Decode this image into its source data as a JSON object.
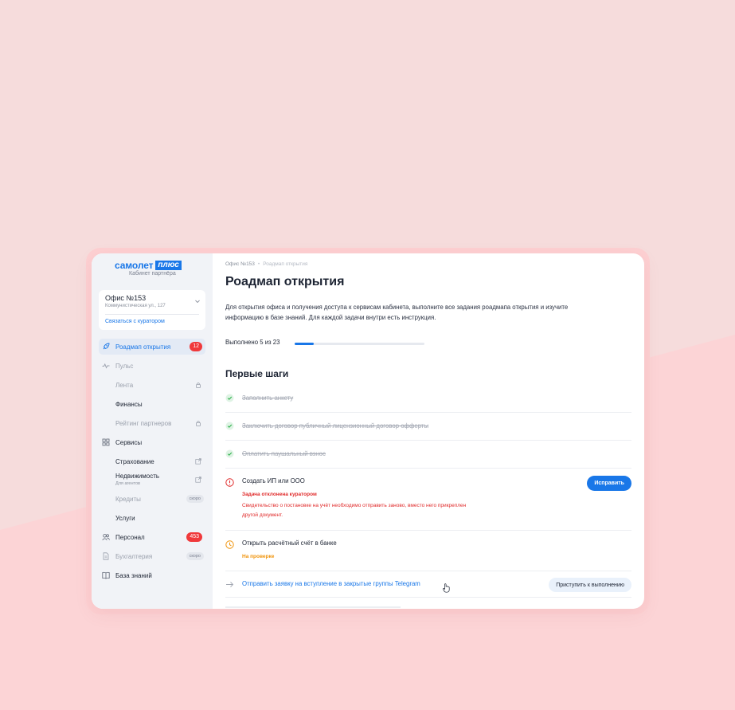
{
  "colors": {
    "background": "#f6dcdc",
    "accent": "#1977e8",
    "danger": "#f0393b",
    "warning": "#f0930a",
    "success": "#2fb24c"
  },
  "brand": {
    "logo_text": "самолет",
    "logo_badge": "плюс",
    "subtitle": "Кабинет партнёра"
  },
  "office": {
    "name": "Офис №153",
    "address": "Коммунистическая ул., 127",
    "contact_link": "Связаться с куратором"
  },
  "sidebar": {
    "items": [
      {
        "label": "Роадмап открытия",
        "icon": "rocket-icon",
        "badge": "12",
        "active": true
      },
      {
        "label": "Пульс",
        "icon": "pulse-icon",
        "muted": true
      },
      {
        "label": "Лента",
        "sub": true,
        "muted": true,
        "right_icon": "lock-icon"
      },
      {
        "label": "Финансы",
        "sub": true
      },
      {
        "label": "Рейтинг партнеров",
        "sub": true,
        "muted": true,
        "right_icon": "lock-icon"
      },
      {
        "label": "Сервисы",
        "icon": "grid-icon"
      },
      {
        "label": "Страхование",
        "sub": true,
        "right_icon": "external-link-icon"
      },
      {
        "label": "Недвижимость",
        "sub": true,
        "hint": "Для агентов",
        "right_icon": "external-link-icon"
      },
      {
        "label": "Кредиты",
        "sub": true,
        "muted": true,
        "soon": "скоро"
      },
      {
        "label": "Услуги",
        "sub": true
      },
      {
        "label": "Персонал",
        "icon": "people-icon",
        "badge": "453"
      },
      {
        "label": "Бухгалтерия",
        "icon": "document-icon",
        "muted": true,
        "soon": "скоро"
      },
      {
        "label": "База знаний",
        "icon": "book-icon"
      }
    ]
  },
  "breadcrumb": {
    "items": [
      "Офис №153",
      "Роадмап открытия"
    ]
  },
  "page": {
    "title": "Роадмап открытия",
    "intro": "Для открытия офиса и получения доступа к сервисам кабинета, выполните все задания роадмапа открытия и изучите информацию в базе знаний.  Для каждой задачи внутри есть инструкция.",
    "progress_label": "Выполнено 5 из 23",
    "progress_fraction": 0.15,
    "section_title": "Первые шаги"
  },
  "tasks": [
    {
      "title": "Заполнить анкету",
      "state": "done",
      "icon": "check-circle-icon"
    },
    {
      "title": "Заключить договор публичный лицензионный договор офферты",
      "state": "done",
      "icon": "check-circle-icon"
    },
    {
      "title": "Оплатить паушальный взнос",
      "state": "done",
      "icon": "check-circle-icon"
    },
    {
      "title": "Создать ИП или ООО",
      "state": "rejected",
      "icon": "alert-circle-icon",
      "status": "Задача отклонена куратором",
      "note": "Свидетельство о постановке на учёт необходимо отправить заново, вместо него прикреплен другой документ.",
      "button": "Исправить"
    },
    {
      "title": "Открыть расчётный счёт в банке",
      "state": "review",
      "icon": "clock-icon",
      "status": "На проверке"
    },
    {
      "title": "Отправить заявку на вступление в закрытые группы Telegram",
      "state": "todo",
      "icon": "arrow-right-icon",
      "button": "Приступить к выполнению"
    }
  ]
}
